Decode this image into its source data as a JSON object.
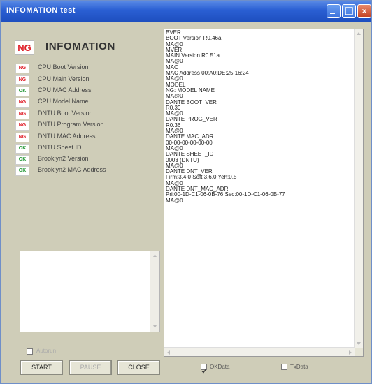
{
  "window": {
    "title": "INFOMATION test",
    "minimize_icon": "minimize-icon",
    "maximize_icon": "maximize-icon",
    "close_glyph": "×"
  },
  "header": {
    "status": "NG",
    "title": "INFOMATION"
  },
  "items": [
    {
      "status": "NG",
      "label": "CPU Boot Version"
    },
    {
      "status": "NG",
      "label": "CPU Main Version"
    },
    {
      "status": "OK",
      "label": "CPU MAC Address"
    },
    {
      "status": "NG",
      "label": "CPU Model Name"
    },
    {
      "status": "NG",
      "label": "DNTU Boot Version"
    },
    {
      "status": "NG",
      "label": "DNTU Program Version"
    },
    {
      "status": "NG",
      "label": "DNTU MAC Address"
    },
    {
      "status": "OK",
      "label": "DNTU Sheet ID"
    },
    {
      "status": "OK",
      "label": "Brooklyn2 Version"
    },
    {
      "status": "OK",
      "label": "Brooklyn2 MAC Address"
    }
  ],
  "autorun": {
    "label": "Autorun",
    "checked": false
  },
  "buttons": {
    "start": "START",
    "pause": "PAUSE",
    "close": "CLOSE"
  },
  "log": [
    "BVER",
    "BOOT Version R0.46a",
    "MA@0",
    "MVER",
    "MAIN Version R0.51a",
    "MA@0",
    "MAC",
    "MAC Address 00:A0:DE:25:16:24",
    "MA@0",
    "MODEL",
    "NG: MODEL NAME",
    "MA@0",
    "DANTE BOOT_VER",
    "R0.39",
    "MA@0",
    "DANTE PROG_VER",
    "R0.36",
    "MA@0",
    "DANTE MAC_ADR",
    "00-00-00-00-00-00",
    "MA@0",
    "DANTE SHEET_ID",
    "0003 (DNTU)",
    "MA@0",
    "DANTE DNT_VER",
    "Firm:3.4.0 Soft:3.6.0 Yeh:0.5",
    "MA@0",
    "DANTE DNT_MAC_ADR",
    "Pri:00-1D-C1-06-0B-76 Sec:00-1D-C1-06-0B-77",
    "MA@0"
  ],
  "bottom_checks": {
    "okdata": "OKData",
    "txdata": "TxData"
  },
  "colors": {
    "ng": "#e0202a",
    "ok": "#2a9a3c",
    "title_bar": "#2a5fd3"
  }
}
